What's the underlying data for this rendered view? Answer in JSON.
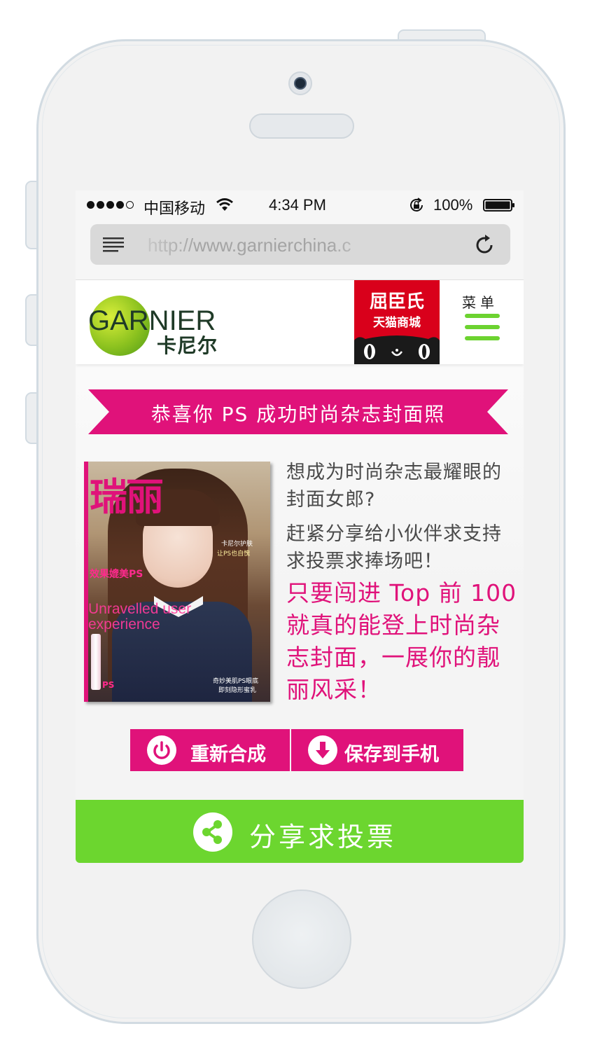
{
  "status_bar": {
    "carrier": "中国移动",
    "time": "4:34 PM",
    "battery": "100%"
  },
  "browser": {
    "url": "http://www.garnierchina.c"
  },
  "header": {
    "brand_name": "GARNIER",
    "brand_name_cn": "卡尼尔",
    "tmall_title": "屈臣氏",
    "tmall_subtitle": "天猫商城",
    "menu_label": "菜单"
  },
  "banner": {
    "text": "恭喜你 PS 成功时尚杂志封面照"
  },
  "cover": {
    "masthead": "瑞丽",
    "tagline": "效果媲美PS",
    "english": "Unravelled user experience",
    "side_text_1": "卡尼尔护肤",
    "side_text_2": "让PS也自愧",
    "bottom_text_1": "奇妙美肌PS眼底",
    "bottom_text_2": "即刻隐形蜜乳",
    "product_label": "PS"
  },
  "content": {
    "intro_1": "想成为时尚杂志最耀眼的封面女郎?",
    "intro_2": "赶紧分享给小伙伴求支持求投票求捧场吧！",
    "promo": "只要闯进 Top 前 100 就真的能登上时尚杂志封面，一展你的靓丽风采！"
  },
  "actions": {
    "restart": "重新合成",
    "save": "保存到手机",
    "share": "分享求投票"
  },
  "colors": {
    "brand_magenta": "#e0127a",
    "brand_green": "#6cd62f",
    "tmall_red": "#d9001b"
  },
  "icons": {
    "restart": "power-icon",
    "save": "download-icon",
    "share": "share-icon"
  }
}
